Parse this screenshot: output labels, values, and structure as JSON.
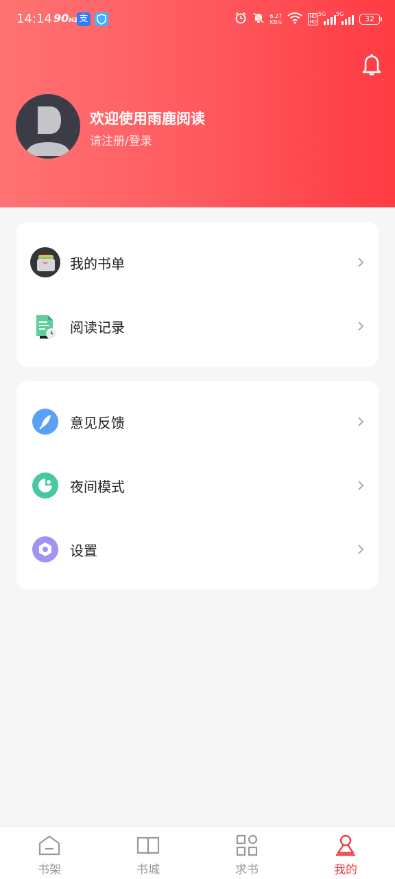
{
  "status_bar": {
    "time": "14:14",
    "refresh_rate": "90",
    "refresh_unit": "HZ",
    "net_speed_value": "6.27",
    "net_speed_unit": "KB/s",
    "hd_badge": "HD",
    "signal_tag_1": "5G",
    "signal_tag_2": "5G",
    "battery": "32",
    "icons": [
      "alipay-icon",
      "shield-app-icon",
      "alarm-icon",
      "mute-icon",
      "wifi-icon",
      "signal-icon",
      "signal-icon",
      "battery-icon"
    ]
  },
  "header": {
    "welcome": "欢迎使用雨鹿阅读",
    "login_prompt": "请注册/登录",
    "bell_icon": "bell-icon",
    "gradient_colors": [
      "#ff7373",
      "#ff3b43"
    ]
  },
  "menu_group_1": [
    {
      "label": "我的书单",
      "icon": "booklist-wallet-icon"
    },
    {
      "label": "阅读记录",
      "icon": "reading-history-icon"
    }
  ],
  "menu_group_2": [
    {
      "label": "意见反馈",
      "icon": "feedback-feather-icon"
    },
    {
      "label": "夜间模式",
      "icon": "night-mode-icon"
    },
    {
      "label": "设置",
      "icon": "settings-hexagon-icon"
    }
  ],
  "bottom_nav": {
    "items": [
      {
        "label": "书架",
        "icon": "bookshelf-icon",
        "active": false
      },
      {
        "label": "书城",
        "icon": "book-store-icon",
        "active": false
      },
      {
        "label": "求书",
        "icon": "request-book-icon",
        "active": false
      },
      {
        "label": "我的",
        "icon": "profile-icon",
        "active": true
      }
    ],
    "active_color": "#ee3d41",
    "inactive_color": "#999999"
  }
}
